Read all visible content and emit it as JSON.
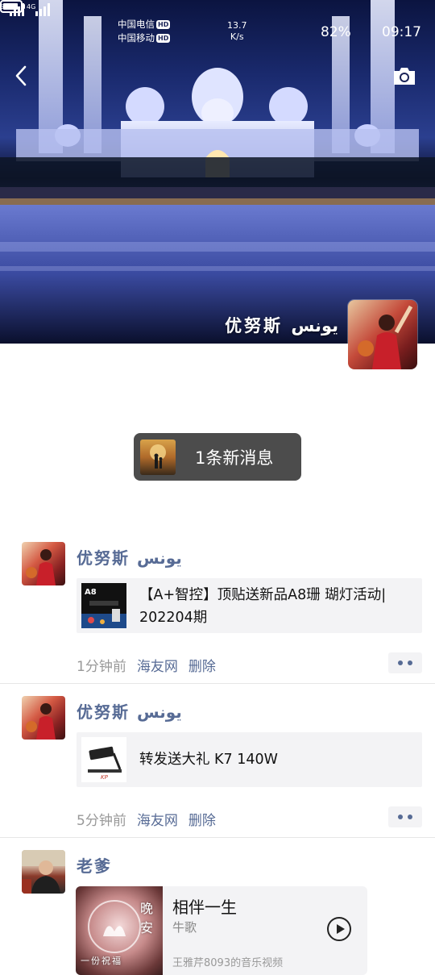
{
  "status_bar": {
    "carrier1": "中国电信",
    "carrier2": "中国移动",
    "hd": "HD",
    "net1": "5G",
    "net2": "4G",
    "speed_value": "13.7",
    "speed_unit": "K/s",
    "battery": "82%",
    "time": "09:17"
  },
  "cover": {
    "name": "优努斯 يونس",
    "back_icon": "chevron-left-icon",
    "camera_icon": "camera-icon"
  },
  "new_messages": {
    "label": "1条新消息"
  },
  "posts": [
    {
      "user": "优努斯 يونس",
      "card_title_line1": "【A+智控】顶贴送新品A8珊 瑚灯活动|",
      "card_title_line2": "202204期",
      "thumb_label": "A8",
      "time": "1分钟前",
      "source": "海友网",
      "delete": "删除"
    },
    {
      "user": "优努斯 يونس",
      "card_title_line1": "转发送大礼 K7 140W",
      "thumb_label": "KP",
      "time": "5分钟前",
      "source": "海友网",
      "delete": "删除"
    },
    {
      "user": "老爹",
      "music_title": "相伴一生",
      "music_artist": "牛歌",
      "music_source": "王雅芹8093的音乐视频",
      "art_text": "晚安",
      "art_text2": "一份祝福"
    }
  ],
  "colors": {
    "link": "#576b95",
    "meta": "#999999",
    "pill": "#4c4c4c"
  }
}
